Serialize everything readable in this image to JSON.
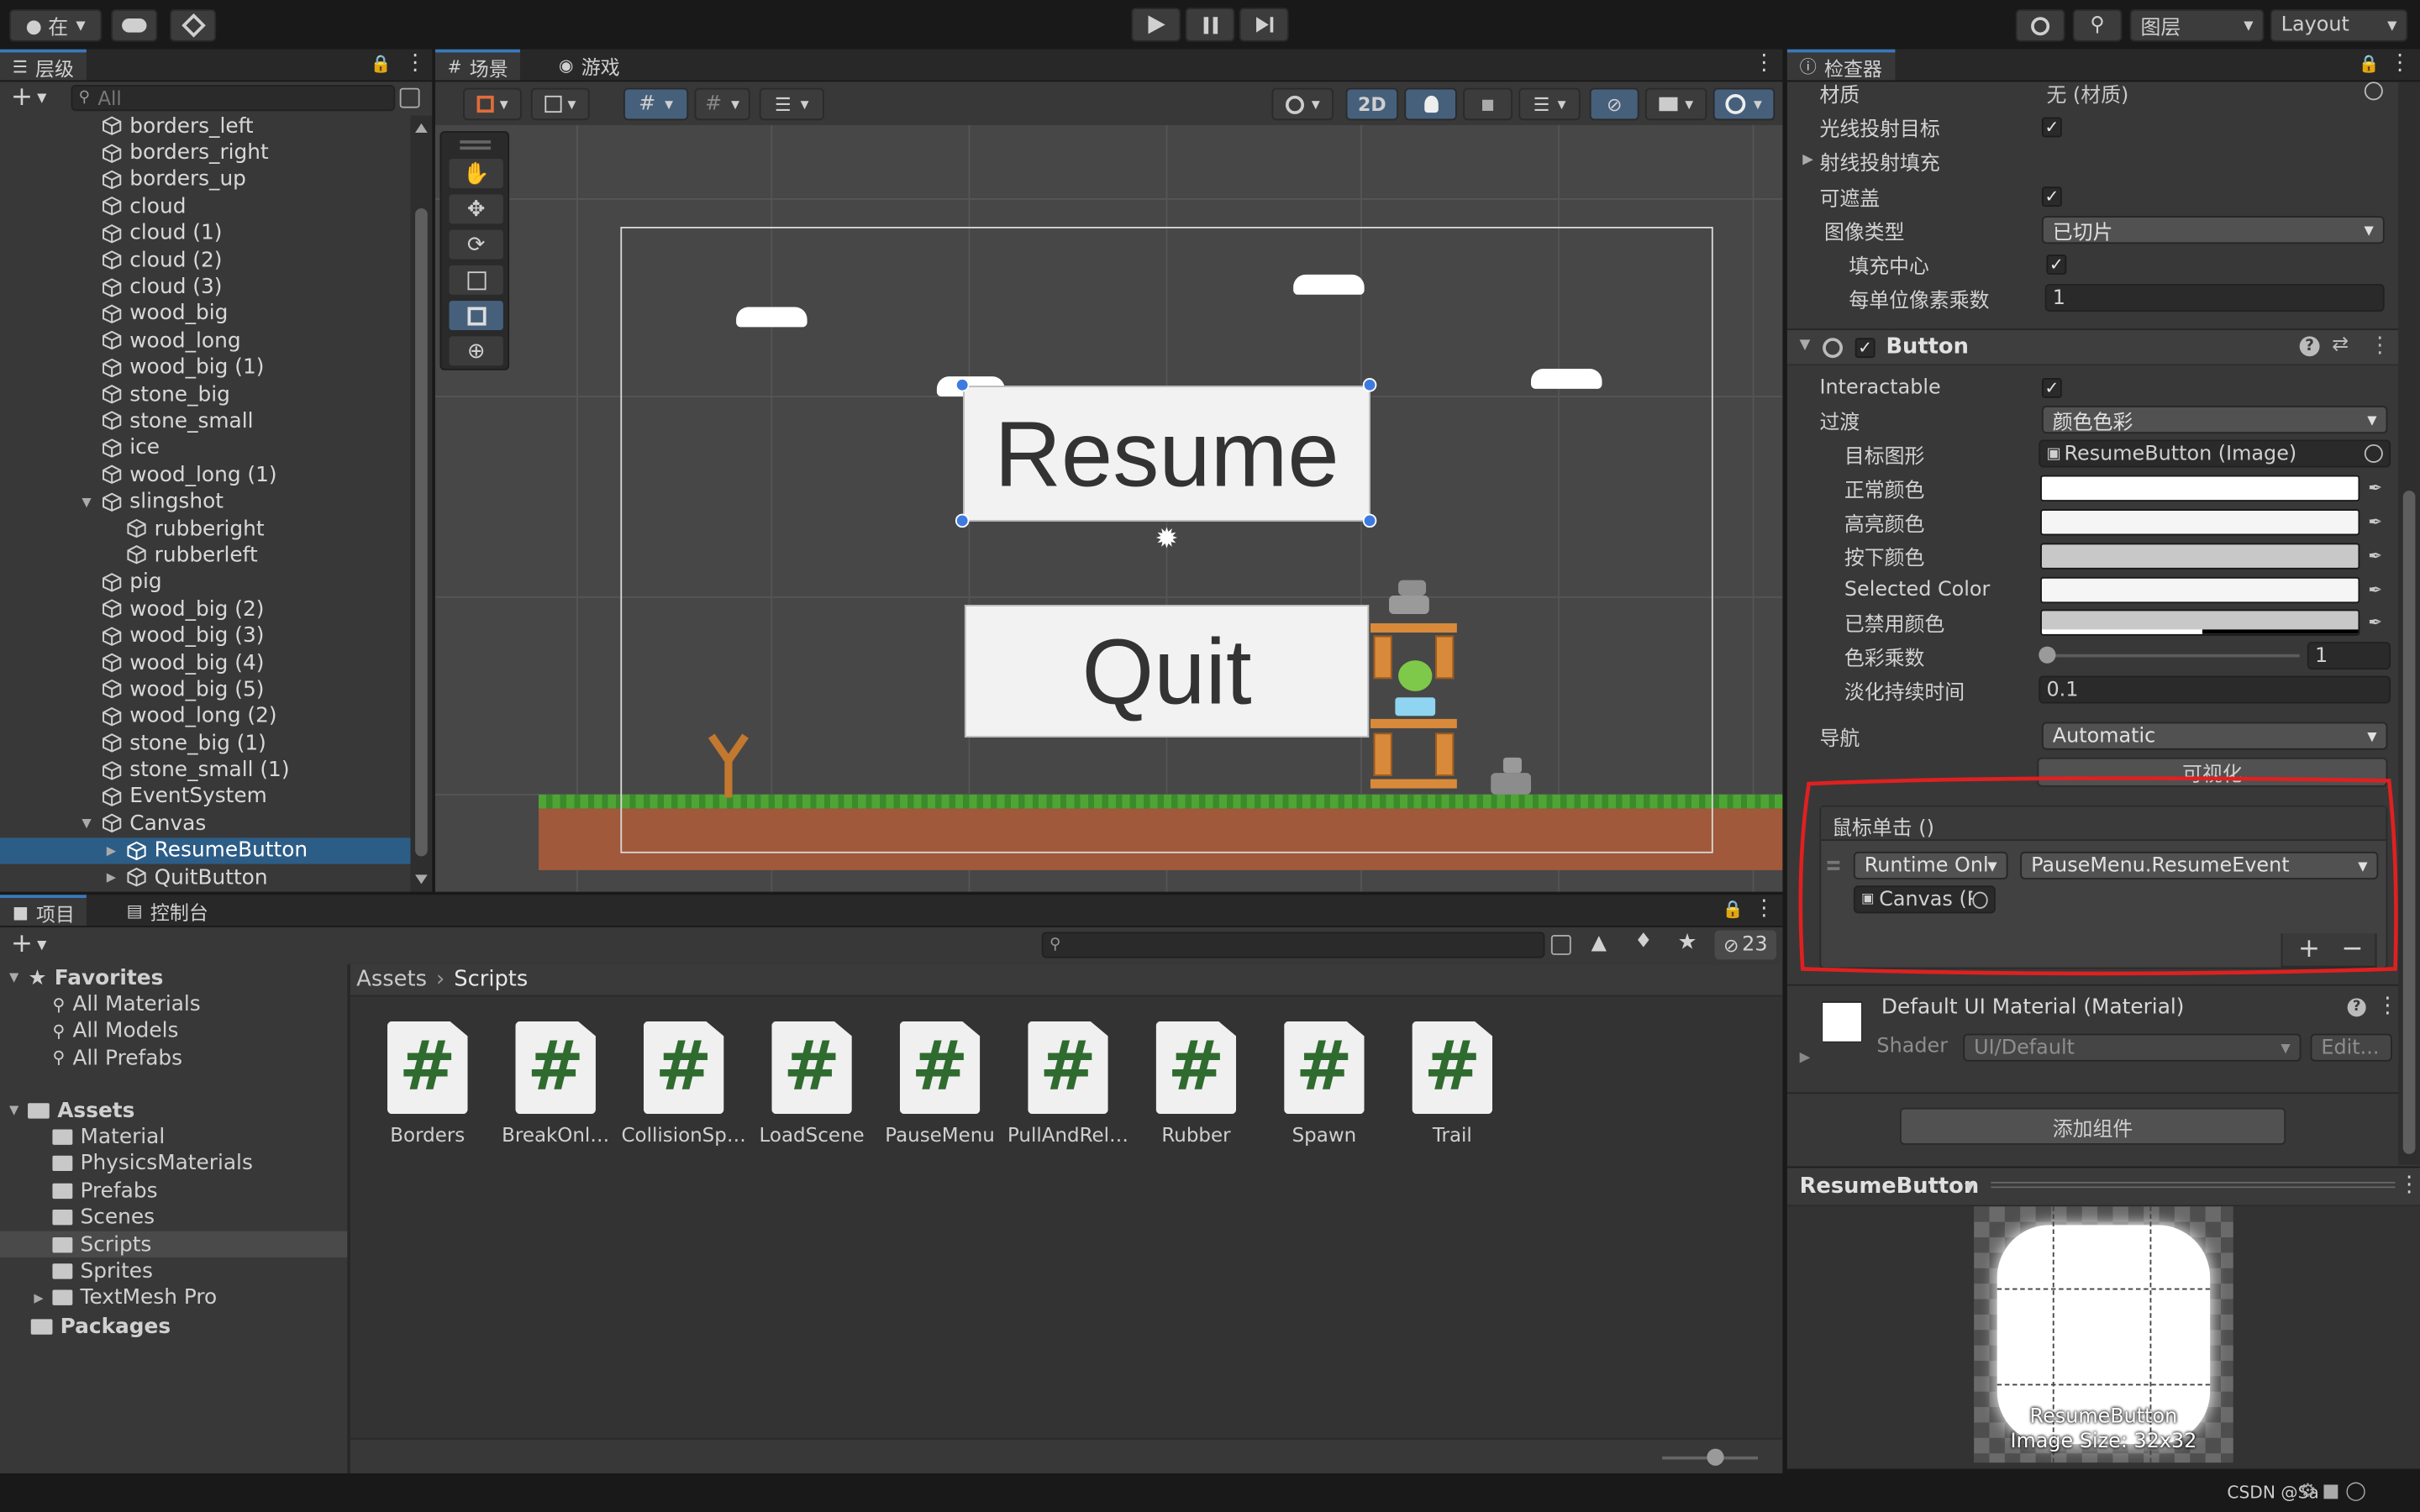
{
  "toolbar": {
    "account_label": "在",
    "layers_label": "图层",
    "layout_label": "Layout"
  },
  "hierarchy": {
    "tab_label": "层级",
    "search_placeholder": "All",
    "items": [
      {
        "label": "borders_left",
        "indent": 0
      },
      {
        "label": "borders_right",
        "indent": 0
      },
      {
        "label": "borders_up",
        "indent": 0
      },
      {
        "label": "cloud",
        "indent": 0
      },
      {
        "label": "cloud (1)",
        "indent": 0
      },
      {
        "label": "cloud (2)",
        "indent": 0
      },
      {
        "label": "cloud (3)",
        "indent": 0
      },
      {
        "label": "wood_big",
        "indent": 0
      },
      {
        "label": "wood_long",
        "indent": 0
      },
      {
        "label": "wood_big (1)",
        "indent": 0
      },
      {
        "label": "stone_big",
        "indent": 0
      },
      {
        "label": "stone_small",
        "indent": 0
      },
      {
        "label": "ice",
        "indent": 0
      },
      {
        "label": "wood_long (1)",
        "indent": 0
      },
      {
        "label": "slingshot",
        "indent": 0,
        "expanded": true
      },
      {
        "label": "rubberight",
        "indent": 1
      },
      {
        "label": "rubberleft",
        "indent": 1
      },
      {
        "label": "pig",
        "indent": 0
      },
      {
        "label": "wood_big (2)",
        "indent": 0
      },
      {
        "label": "wood_big (3)",
        "indent": 0
      },
      {
        "label": "wood_big (4)",
        "indent": 0
      },
      {
        "label": "wood_big (5)",
        "indent": 0
      },
      {
        "label": "wood_long (2)",
        "indent": 0
      },
      {
        "label": "stone_big (1)",
        "indent": 0
      },
      {
        "label": "stone_small (1)",
        "indent": 0
      },
      {
        "label": "EventSystem",
        "indent": 0
      },
      {
        "label": "Canvas",
        "indent": 0,
        "expanded": true
      },
      {
        "label": "ResumeButton",
        "indent": 1,
        "collapsed": true,
        "selected": true
      },
      {
        "label": "QuitButton",
        "indent": 1,
        "collapsed": true
      }
    ]
  },
  "scene": {
    "tab_scene": "场景",
    "tab_game": "游戏",
    "mode_2d": "2D",
    "resume_text": "Resume",
    "quit_text": "Quit"
  },
  "inspector": {
    "tab_label": "检查器",
    "image": {
      "material_label": "材质",
      "material_value": "无 (材质)",
      "raycast_target_label": "光线投射目标",
      "raycast_padding_label": "射线投射填充",
      "maskable_label": "可遮盖",
      "image_type_label": "图像类型",
      "image_type_value": "已切片",
      "fill_center_label": "填充中心",
      "ppu_label": "每单位像素乘数",
      "ppu_value": "1"
    },
    "button": {
      "title": "Button",
      "interactable_label": "Interactable",
      "transition_label": "过渡",
      "transition_value": "颜色色彩",
      "target_graphic_label": "目标图形",
      "target_graphic_value": "ResumeButton (Image)",
      "normal_color_label": "正常颜色",
      "highlighted_color_label": "高亮颜色",
      "pressed_color_label": "按下颜色",
      "selected_color_label": "Selected Color",
      "disabled_color_label": "已禁用颜色",
      "color_multiplier_label": "色彩乘数",
      "color_multiplier_value": "1",
      "fade_duration_label": "淡化持续时间",
      "fade_duration_value": "0.1",
      "navigation_label": "导航",
      "navigation_value": "Automatic",
      "visualize_label": "可视化",
      "colors": {
        "normal": "#ffffff",
        "highlighted": "#f5f5f5",
        "pressed": "#c8c8c8",
        "selected": "#f5f5f5",
        "disabled": "#c8c8c8"
      },
      "color_multiplier": 1
    },
    "onclick": {
      "header": "鼠标单击 ()",
      "runtime_value": "Runtime Onl",
      "function_value": "PauseMenu.ResumeEvent",
      "object_value": "Canvas (P",
      "add": "+",
      "remove": "−"
    },
    "material": {
      "title": "Default UI Material (Material)",
      "shader_label": "Shader",
      "shader_value": "UI/Default",
      "edit_label": "Edit..."
    },
    "add_component_label": "添加组件",
    "preview": {
      "title": "ResumeButton",
      "name": "ResumeButton",
      "size": "Image Size: 32x32"
    }
  },
  "project": {
    "tab_project": "项目",
    "tab_console": "控制台",
    "hidden_count": "23",
    "breadcrumb": [
      "Assets",
      "Scripts"
    ],
    "favorites_label": "Favorites",
    "favorites": [
      "All Materials",
      "All Models",
      "All Prefabs"
    ],
    "assets_label": "Assets",
    "asset_folders": [
      "Material",
      "PhysicsMaterials",
      "Prefabs",
      "Scenes",
      "Scripts",
      "Sprites",
      "TextMesh Pro"
    ],
    "packages_label": "Packages",
    "scripts": [
      "Borders",
      "BreakOnl…",
      "CollisionSp…",
      "LoadScene",
      "PauseMenu",
      "PullAndRel…",
      "Rubber",
      "Spawn",
      "Trail"
    ]
  },
  "status": {
    "watermark": "CSDN @Sa"
  }
}
